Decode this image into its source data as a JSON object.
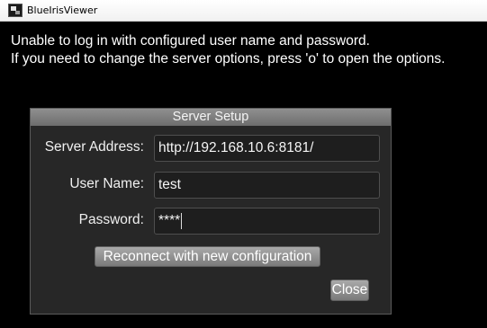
{
  "window": {
    "title": "BlueIrisViewer",
    "icon": "blueiris-app-icon"
  },
  "message": {
    "line1": "Unable to log in with configured user name and password.",
    "line2": "If you need to change the server options, press 'o' to open the options."
  },
  "dialog": {
    "title": "Server Setup",
    "fields": [
      {
        "label": "Server Address:",
        "value": "http://192.168.10.6:8181/"
      },
      {
        "label": "User Name:",
        "value": "test"
      },
      {
        "label": "Password:",
        "value": "****"
      }
    ],
    "reconnect_label": "Reconnect with new configuration",
    "close_label": "Close"
  }
}
